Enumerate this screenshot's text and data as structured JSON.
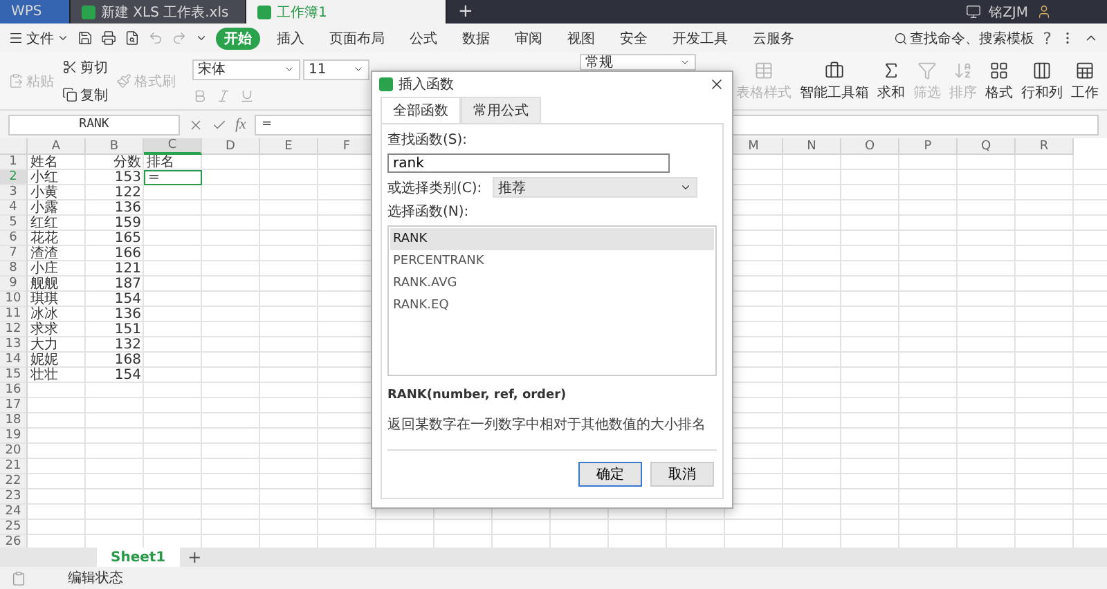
{
  "title_bar": {
    "tabs": [
      {
        "label": "WPS",
        "kind": "brand",
        "selected": false
      },
      {
        "label": "新建 XLS 工作表.xls",
        "kind": "doc",
        "selected": false
      },
      {
        "label": "工作簿1",
        "kind": "doc",
        "selected": true
      }
    ],
    "new_tab": "+",
    "user": "铭ZJM"
  },
  "menu": {
    "file": "文件",
    "items": [
      {
        "label": "开始",
        "selected": true
      },
      {
        "label": "插入",
        "selected": false
      },
      {
        "label": "页面布局",
        "selected": false
      },
      {
        "label": "公式",
        "selected": false
      },
      {
        "label": "数据",
        "selected": false
      },
      {
        "label": "审阅",
        "selected": false
      },
      {
        "label": "视图",
        "selected": false
      },
      {
        "label": "安全",
        "selected": false
      },
      {
        "label": "开发工具",
        "selected": false
      },
      {
        "label": "云服务",
        "selected": false
      }
    ],
    "search": "查找命令、搜索模板",
    "help": "?"
  },
  "ribbon": {
    "clipboard": [
      {
        "label": "粘贴",
        "kind": "paste",
        "disabled": true
      },
      {
        "label": "剪切",
        "kind": "cut",
        "disabled": false
      },
      {
        "label": "复制",
        "kind": "copy",
        "disabled": false
      },
      {
        "label": "格式刷",
        "kind": "brush",
        "disabled": true
      }
    ],
    "font": "宋体",
    "size": "11",
    "number_format": "常规",
    "tools": [
      {
        "label": "表格样式",
        "kind": "table",
        "disabled": true
      },
      {
        "label": "智能工具箱",
        "kind": "toolbox",
        "disabled": false
      },
      {
        "label": "求和",
        "kind": "sum",
        "disabled": false
      },
      {
        "label": "筛选",
        "kind": "filter",
        "disabled": true
      },
      {
        "label": "排序",
        "kind": "sort",
        "disabled": true
      },
      {
        "label": "格式",
        "kind": "format",
        "disabled": false
      },
      {
        "label": "行和列",
        "kind": "rows",
        "disabled": false
      },
      {
        "label": "工作",
        "kind": "sheet",
        "disabled": false
      }
    ]
  },
  "formula_bar": {
    "name_box": "RANK",
    "fx_label": "fx",
    "formula": "="
  },
  "sheet": {
    "columns": [
      {
        "label": "A",
        "kind": "text",
        "selected": false
      },
      {
        "label": "B",
        "kind": "number",
        "selected": false
      },
      {
        "label": "C",
        "kind": "text",
        "selected": true
      },
      {
        "label": "D",
        "selected": false
      },
      {
        "label": "E",
        "selected": false
      },
      {
        "label": "F",
        "selected": false
      },
      {
        "label": "M",
        "selected": false
      },
      {
        "label": "N",
        "selected": false
      },
      {
        "label": "O",
        "selected": false
      },
      {
        "label": "P",
        "selected": false
      },
      {
        "label": "Q",
        "selected": false
      },
      {
        "label": "R",
        "selected": false
      }
    ],
    "rows": [
      {
        "number": "1",
        "selected": false,
        "cells": [
          "姓名",
          "分数",
          "排名"
        ]
      },
      {
        "number": "2",
        "selected": true,
        "cells": [
          "小红",
          "153",
          "="
        ]
      },
      {
        "number": "3",
        "selected": false,
        "cells": [
          "小黄",
          "122"
        ]
      },
      {
        "number": "4",
        "selected": false,
        "cells": [
          "小露",
          "136"
        ]
      },
      {
        "number": "5",
        "selected": false,
        "cells": [
          "红红",
          "159"
        ]
      },
      {
        "number": "6",
        "selected": false,
        "cells": [
          "花花",
          "165"
        ]
      },
      {
        "number": "7",
        "selected": false,
        "cells": [
          "渣渣",
          "166"
        ]
      },
      {
        "number": "8",
        "selected": false,
        "cells": [
          "小庄",
          "121"
        ]
      },
      {
        "number": "9",
        "selected": false,
        "cells": [
          "舰舰",
          "187"
        ]
      },
      {
        "number": "10",
        "selected": false,
        "cells": [
          "琪琪",
          "154"
        ]
      },
      {
        "number": "11",
        "selected": false,
        "cells": [
          "冰冰",
          "136"
        ]
      },
      {
        "number": "12",
        "selected": false,
        "cells": [
          "求求",
          "151"
        ]
      },
      {
        "number": "13",
        "selected": false,
        "cells": [
          "大力",
          "132"
        ]
      },
      {
        "number": "14",
        "selected": false,
        "cells": [
          "妮妮",
          "168"
        ]
      },
      {
        "number": "15",
        "selected": false,
        "cells": [
          "壮壮",
          "154"
        ]
      },
      {
        "number": "16",
        "selected": false,
        "cells": []
      },
      {
        "number": "17",
        "selected": false,
        "cells": []
      },
      {
        "number": "18",
        "selected": false,
        "cells": []
      },
      {
        "number": "19",
        "selected": false,
        "cells": []
      },
      {
        "number": "20",
        "selected": false,
        "cells": []
      },
      {
        "number": "21",
        "selected": false,
        "cells": []
      },
      {
        "number": "22",
        "selected": false,
        "cells": []
      },
      {
        "number": "23",
        "selected": false,
        "cells": []
      },
      {
        "number": "24",
        "selected": false,
        "cells": []
      },
      {
        "number": "25",
        "selected": false,
        "cells": []
      },
      {
        "number": "26",
        "selected": false,
        "cells": []
      }
    ]
  },
  "sheet_tabs": [
    {
      "label": "Sheet1",
      "selected": true
    }
  ],
  "add_sheet": "+",
  "status_bar": {
    "text": "编辑状态"
  },
  "dialog": {
    "title": "插入函数",
    "tabs": [
      {
        "label": "全部函数",
        "selected": true
      },
      {
        "label": "常用公式",
        "selected": false
      }
    ],
    "search_label": "查找函数(S):",
    "search_value": "rank",
    "category_label": "或选择类别(C):",
    "category_value": "推荐",
    "list_label": "选择函数(N):",
    "functions": [
      {
        "name": "RANK",
        "selected": true
      },
      {
        "name": "PERCENTRANK",
        "selected": false
      },
      {
        "name": "RANK.AVG",
        "selected": false
      },
      {
        "name": "RANK.EQ",
        "selected": false
      }
    ],
    "signature": "RANK(number, ref, order)",
    "description": "返回某数字在一列数字中相对于其他数值的大小排名",
    "buttons": [
      {
        "label": "确定",
        "kind": "primary"
      },
      {
        "label": "取消",
        "kind": "default"
      }
    ]
  }
}
